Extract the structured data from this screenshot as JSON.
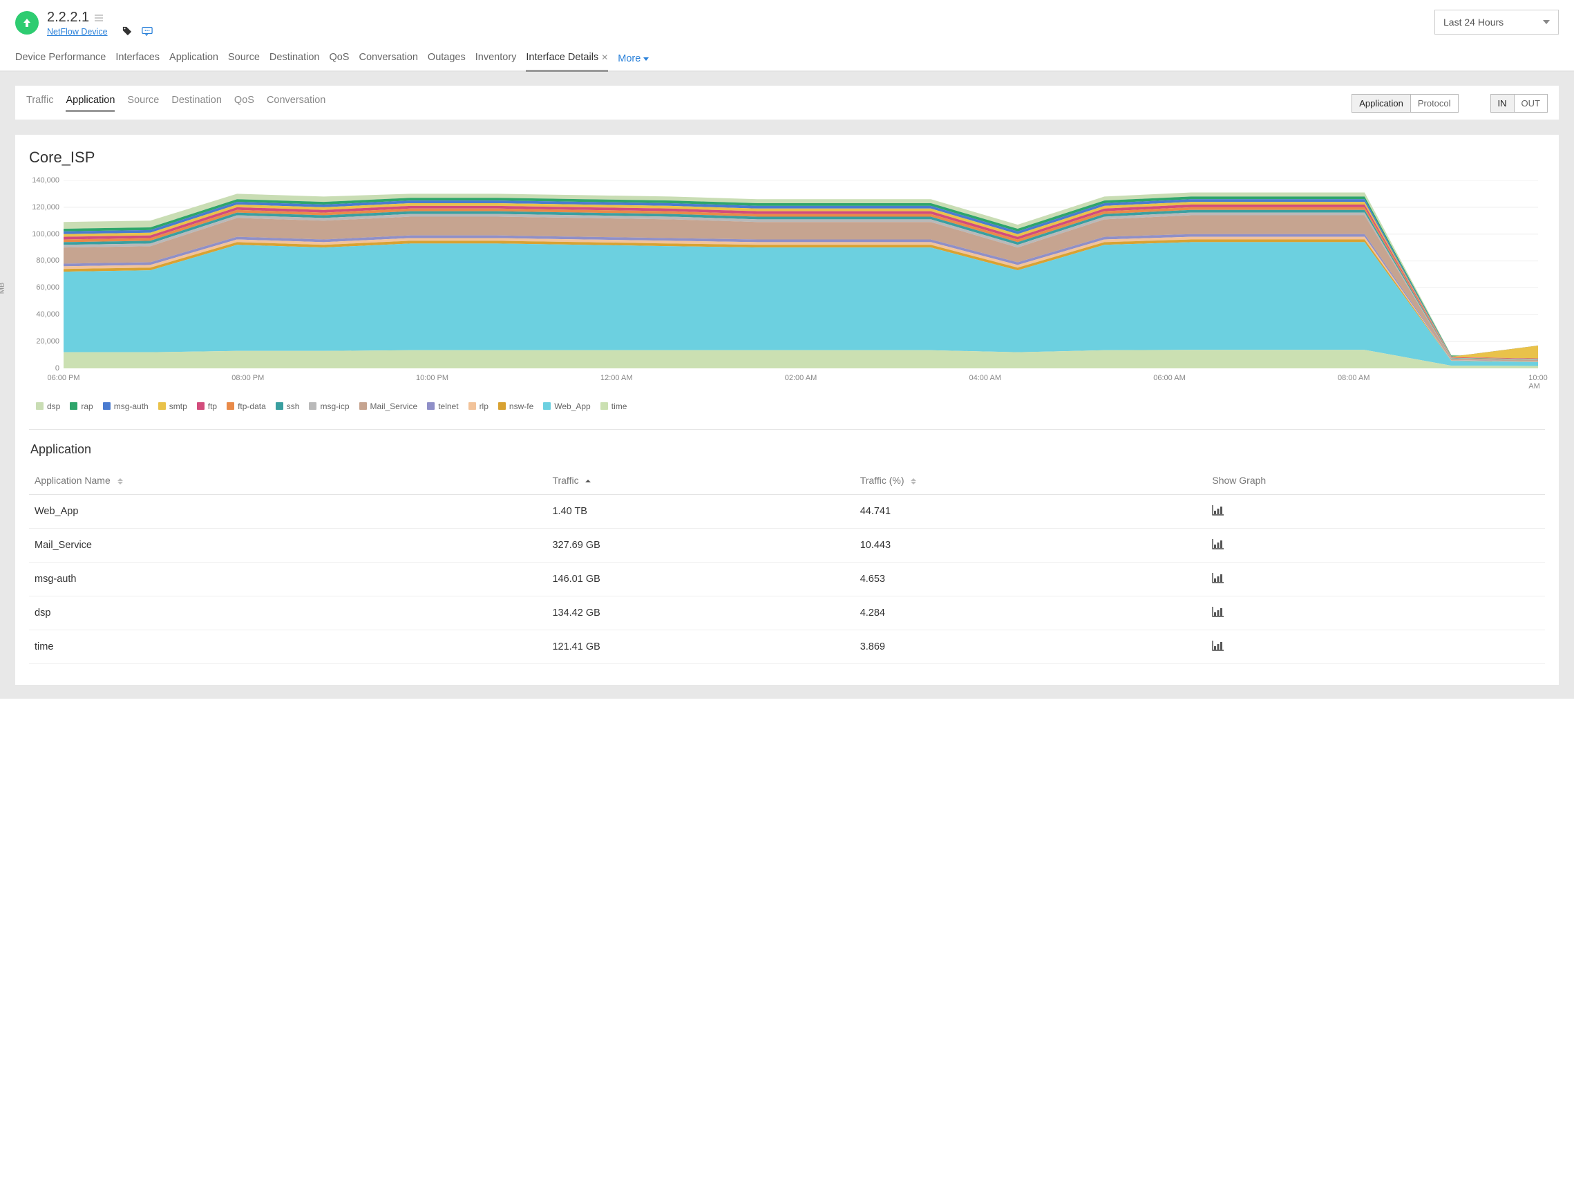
{
  "device": {
    "ip": "2.2.2.1",
    "type": "NetFlow Device"
  },
  "time_range": "Last 24 Hours",
  "main_tabs": [
    {
      "label": "Device Performance",
      "active": false,
      "closable": false
    },
    {
      "label": "Interfaces",
      "active": false,
      "closable": false
    },
    {
      "label": "Application",
      "active": false,
      "closable": false
    },
    {
      "label": "Source",
      "active": false,
      "closable": false
    },
    {
      "label": "Destination",
      "active": false,
      "closable": false
    },
    {
      "label": "QoS",
      "active": false,
      "closable": false
    },
    {
      "label": "Conversation",
      "active": false,
      "closable": false
    },
    {
      "label": "Outages",
      "active": false,
      "closable": false
    },
    {
      "label": "Inventory",
      "active": false,
      "closable": false
    },
    {
      "label": "Interface Details",
      "active": true,
      "closable": true
    }
  ],
  "more_label": "More",
  "sub_tabs": [
    {
      "label": "Traffic",
      "active": false
    },
    {
      "label": "Application",
      "active": true
    },
    {
      "label": "Source",
      "active": false
    },
    {
      "label": "Destination",
      "active": false
    },
    {
      "label": "QoS",
      "active": false
    },
    {
      "label": "Conversation",
      "active": false
    }
  ],
  "view_toggle": {
    "options": [
      "Application",
      "Protocol"
    ],
    "active": "Application"
  },
  "dir_toggle": {
    "options": [
      "IN",
      "OUT"
    ],
    "active": "IN"
  },
  "panel_title": "Core_ISP",
  "chart_data": {
    "type": "area",
    "title": "Core_ISP",
    "ylabel": "MB",
    "ylim": [
      0,
      140000
    ],
    "y_ticks": [
      0,
      20000,
      40000,
      60000,
      80000,
      100000,
      120000,
      140000
    ],
    "x_ticks": [
      "06:00 PM",
      "08:00 PM",
      "10:00 PM",
      "12:00 AM",
      "02:00 AM",
      "04:00 AM",
      "06:00 AM",
      "08:00 AM",
      "10:00 AM"
    ],
    "legend": [
      "dsp",
      "rap",
      "msg-auth",
      "smtp",
      "ftp",
      "ftp-data",
      "ssh",
      "msg-icp",
      "Mail_Service",
      "telnet",
      "rlp",
      "nsw-fe",
      "Web_App",
      "time"
    ],
    "categories": [
      "06:00 PM",
      "07:00 PM",
      "08:00 PM",
      "09:00 PM",
      "10:00 PM",
      "11:00 PM",
      "12:00 AM",
      "01:00 AM",
      "02:00 AM",
      "03:00 AM",
      "04:00 AM",
      "05:00 AM",
      "06:00 AM",
      "07:00 AM",
      "08:00 AM",
      "09:00 AM",
      "09:30 AM",
      "10:00 AM"
    ],
    "series": [
      {
        "name": "dsp",
        "color": "#c9ddb4",
        "values": [
          109000,
          110000,
          130000,
          128000,
          130000,
          130000,
          129000,
          128000,
          126000,
          126000,
          126000,
          107000,
          128000,
          131000,
          131000,
          131000,
          10000,
          9000
        ]
      },
      {
        "name": "rap",
        "color": "#2ea56b",
        "values": [
          104000,
          105000,
          126000,
          124000,
          127000,
          127000,
          126000,
          125000,
          123000,
          123000,
          123000,
          104000,
          125000,
          128000,
          128000,
          128000,
          9500,
          8500
        ]
      },
      {
        "name": "msg-auth",
        "color": "#4a7bd0",
        "values": [
          102000,
          103000,
          124000,
          122000,
          125000,
          125000,
          124000,
          123000,
          121000,
          121000,
          121000,
          102000,
          123000,
          126000,
          126000,
          126000,
          9000,
          8000
        ]
      },
      {
        "name": "smtp",
        "color": "#e9c24a",
        "values": [
          100000,
          101000,
          122000,
          120000,
          123000,
          123000,
          122000,
          121000,
          119000,
          119000,
          119000,
          100000,
          121000,
          124000,
          124000,
          124000,
          8700,
          17000
        ]
      },
      {
        "name": "ftp",
        "color": "#d24c7c",
        "values": [
          98000,
          99000,
          120000,
          118000,
          121000,
          121000,
          120000,
          119000,
          117000,
          117000,
          117000,
          98000,
          119000,
          122000,
          122000,
          122000,
          8400,
          7400
        ]
      },
      {
        "name": "ftp-data",
        "color": "#e98a49",
        "values": [
          96000,
          97000,
          118000,
          116000,
          119000,
          119000,
          118000,
          117000,
          115000,
          115000,
          115000,
          96000,
          117000,
          120000,
          120000,
          120000,
          8100,
          7100
        ]
      },
      {
        "name": "ssh",
        "color": "#3a9fa0",
        "values": [
          94000,
          95000,
          116000,
          114000,
          117000,
          117000,
          116000,
          115000,
          113000,
          113000,
          113000,
          94000,
          115000,
          118000,
          118000,
          118000,
          7800,
          6800
        ]
      },
      {
        "name": "msg-icp",
        "color": "#b9b9b9",
        "values": [
          92000,
          93000,
          114000,
          112000,
          115000,
          115000,
          114000,
          113000,
          111000,
          111000,
          111000,
          92000,
          113000,
          116000,
          116000,
          116000,
          7500,
          6500
        ]
      },
      {
        "name": "Mail_Service",
        "color": "#c6a490",
        "values": [
          90000,
          91000,
          112000,
          110000,
          113000,
          113000,
          112000,
          111000,
          109000,
          109000,
          109000,
          90000,
          111000,
          114000,
          114000,
          114000,
          7200,
          6200
        ]
      },
      {
        "name": "telnet",
        "color": "#8f8fc8",
        "values": [
          78000,
          79000,
          98000,
          96000,
          99000,
          99000,
          98000,
          97000,
          96000,
          96000,
          96000,
          79000,
          98000,
          100000,
          100000,
          100000,
          6200,
          5300
        ]
      },
      {
        "name": "rlp",
        "color": "#f2c39a",
        "values": [
          76000,
          77000,
          96000,
          94000,
          97000,
          97000,
          96000,
          95000,
          94000,
          94000,
          94000,
          77000,
          96000,
          98000,
          98000,
          98000,
          6000,
          5100
        ]
      },
      {
        "name": "nsw-fe",
        "color": "#d8a232",
        "values": [
          74000,
          75000,
          94000,
          92000,
          95000,
          95000,
          94000,
          93000,
          92000,
          92000,
          92000,
          75000,
          94000,
          96000,
          96000,
          96000,
          5800,
          4900
        ]
      },
      {
        "name": "Web_App",
        "color": "#6cd0e0",
        "values": [
          72000,
          73000,
          92000,
          90000,
          93000,
          93000,
          92000,
          91000,
          90000,
          90000,
          90000,
          73000,
          92000,
          94000,
          94000,
          94000,
          5600,
          4700
        ]
      },
      {
        "name": "time",
        "color": "#cbe0b2",
        "values": [
          12000,
          12000,
          13000,
          13000,
          13500,
          13500,
          13500,
          13500,
          13500,
          13500,
          13500,
          12000,
          13500,
          13800,
          13800,
          13800,
          2000,
          1800
        ]
      }
    ],
    "note": "Series values represent cumulative (stacked) MB readings estimated from the chart. Each row is the top boundary of that layer; the area drawn for a series is between its values and the series listed after it."
  },
  "table": {
    "title": "Application",
    "columns": [
      "Application Name",
      "Traffic",
      "Traffic (%)",
      "Show Graph"
    ],
    "rows": [
      {
        "name": "Web_App",
        "traffic": "1.40 TB",
        "pct": "44.741"
      },
      {
        "name": "Mail_Service",
        "traffic": "327.69 GB",
        "pct": "10.443"
      },
      {
        "name": "msg-auth",
        "traffic": "146.01 GB",
        "pct": "4.653"
      },
      {
        "name": "dsp",
        "traffic": "134.42 GB",
        "pct": "4.284"
      },
      {
        "name": "time",
        "traffic": "121.41 GB",
        "pct": "3.869"
      }
    ]
  }
}
